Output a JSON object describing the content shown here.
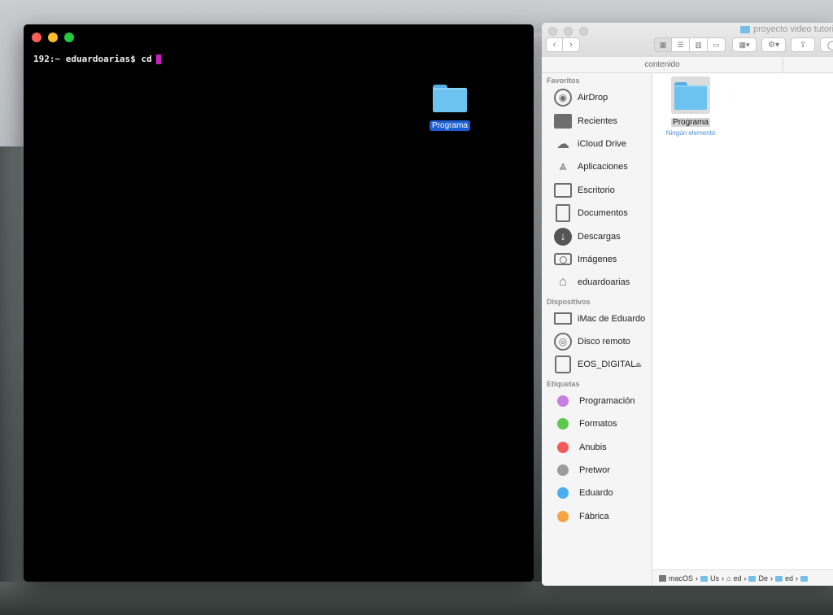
{
  "terminal": {
    "prompt": "192:~ eduardoarias$ cd"
  },
  "desktop": {
    "folder_label": "Programa"
  },
  "finder": {
    "title": "proyecto video tutori",
    "column_header": "contenido",
    "sidebar": {
      "favorites_title": "Favoritos",
      "favorites": [
        {
          "label": "AirDrop",
          "icon": "airdrop-icon"
        },
        {
          "label": "Recientes",
          "icon": "recents-icon"
        },
        {
          "label": "iCloud Drive",
          "icon": "cloud-icon"
        },
        {
          "label": "Aplicaciones",
          "icon": "applications-icon"
        },
        {
          "label": "Escritorio",
          "icon": "desktop-icon"
        },
        {
          "label": "Documentos",
          "icon": "documents-icon"
        },
        {
          "label": "Descargas",
          "icon": "downloads-icon"
        },
        {
          "label": "Imágenes",
          "icon": "camera-icon"
        },
        {
          "label": "eduardoarias",
          "icon": "home-icon"
        }
      ],
      "devices_title": "Dispositivos",
      "devices": [
        {
          "label": "iMac de Eduardo",
          "icon": "imac-icon"
        },
        {
          "label": "Disco remoto",
          "icon": "disc-icon"
        },
        {
          "label": "EOS_DIGITAL",
          "icon": "drive-icon"
        }
      ],
      "tags_title": "Etiquetas",
      "tags": [
        {
          "label": "Programación",
          "color": "#c77ee0"
        },
        {
          "label": "Formatos",
          "color": "#5ec84e"
        },
        {
          "label": "Anubis",
          "color": "#f35a5a"
        },
        {
          "label": "Pretwor",
          "color": "#9c9c9c"
        },
        {
          "label": "Eduardo",
          "color": "#4aaef0"
        },
        {
          "label": "Fábrica",
          "color": "#f5a442"
        }
      ]
    },
    "content": {
      "folder_name": "Programa",
      "folder_subtitle": "Ningún elemento"
    },
    "pathbar": {
      "items": [
        "macOS",
        "Us",
        "ed",
        "De",
        "ed"
      ]
    }
  }
}
